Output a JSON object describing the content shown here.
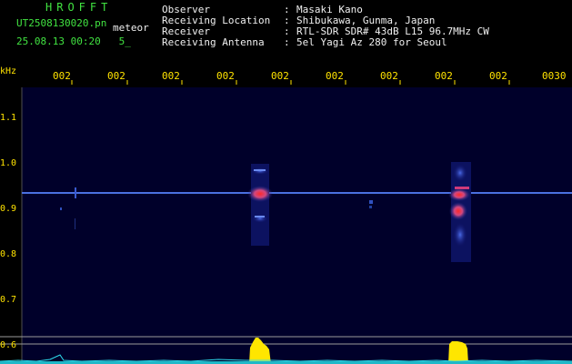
{
  "header": {
    "app_title": "HROFFT",
    "file_name": "UT2508130020.pn",
    "detection_type": "meteor",
    "date_time": "25.08.13 00:20",
    "count": "5_"
  },
  "station_info": [
    {
      "label": "Observer",
      "value": "Masaki Kano"
    },
    {
      "label": "Receiving Location",
      "value": "Shibukawa, Gunma, Japan"
    },
    {
      "label": "Receiver",
      "value": "RTL-SDR SDR# 43dB L15 96.7MHz CW"
    },
    {
      "label": "Receiving Antenna",
      "value": "5el Yagi Az 280 for Seoul"
    }
  ],
  "separator": ":",
  "time_axis": {
    "labels": [
      "002",
      "002",
      "002",
      "002",
      "002",
      "002",
      "002",
      "002",
      "002",
      "0030"
    ]
  },
  "freq_axis": {
    "unit": "kHz",
    "labels": [
      "1.1",
      "1.0",
      "0.9",
      "0.8",
      "0.7",
      "0.6"
    ]
  },
  "colors": {
    "text_green": "#41e341",
    "text_white": "#f0f0f0",
    "tick_yellow": "#ffe300",
    "spectrogram_bg": "#00002a",
    "carrier_line": "#4a70e0",
    "power_histogram": "#ffe600",
    "noise_floor": "#2ee0f0"
  }
}
